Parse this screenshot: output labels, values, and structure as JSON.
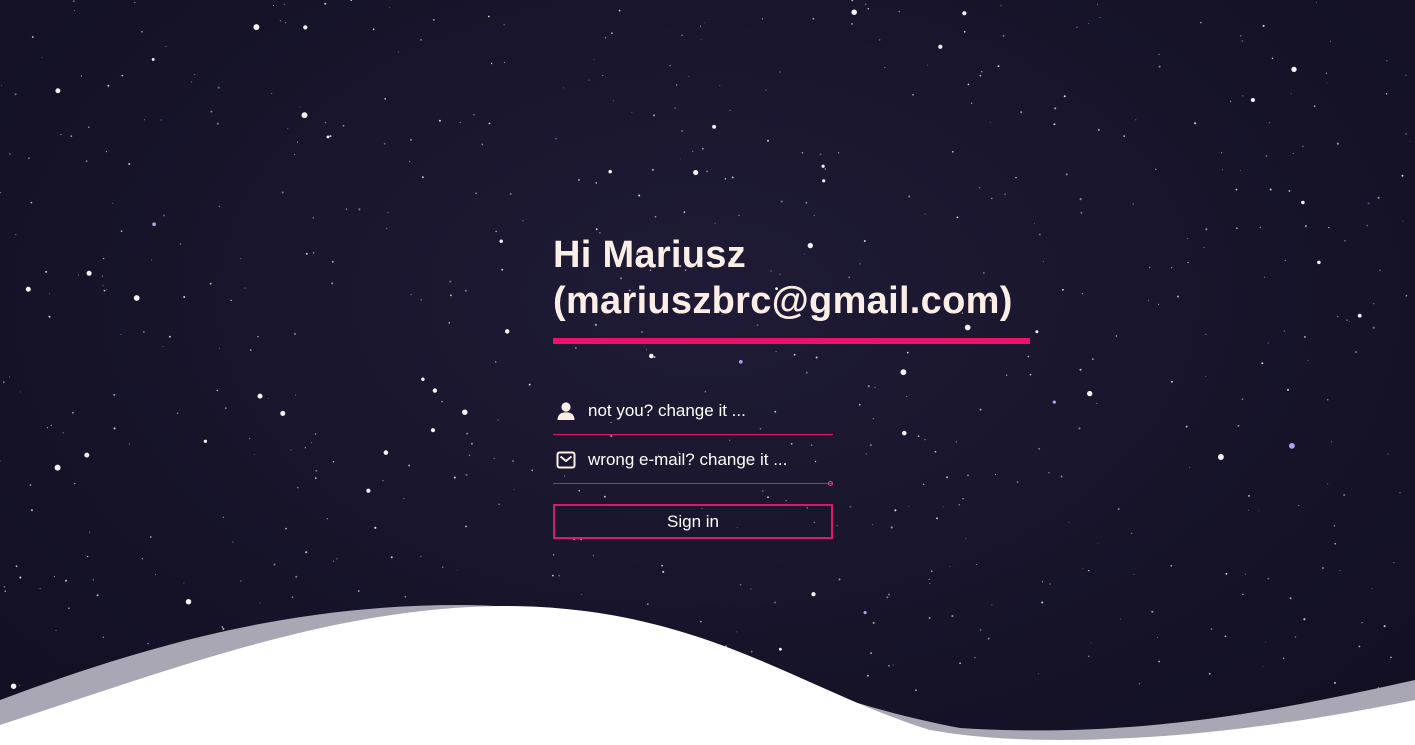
{
  "greeting": {
    "line1": "Hi Mariusz",
    "line2": "(mariuszbrc@gmail.com)"
  },
  "form": {
    "name_field": {
      "icon": "user-icon",
      "placeholder": "not you? change it ...",
      "value": ""
    },
    "email_field": {
      "icon": "envelope-icon",
      "placeholder": "wrong e-mail? change it ...",
      "value": ""
    },
    "submit_label": "Sign in"
  },
  "colors": {
    "background": "#17142a",
    "accent": "#f0106c",
    "text": "#fbeee6",
    "wave_front": "#ffffff",
    "wave_back": "#a9a7b3"
  }
}
